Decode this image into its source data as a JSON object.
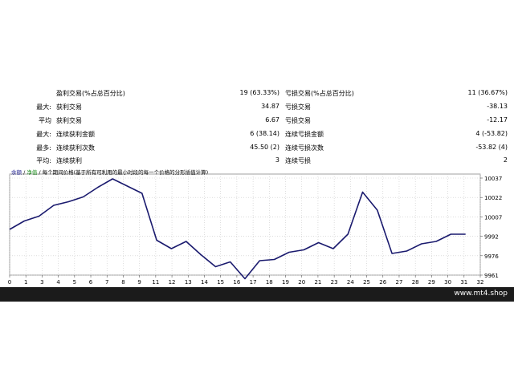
{
  "stats": [
    {
      "prefix": "",
      "label": "盈利交易(%占总百分比)",
      "value": "19 (63.33%)",
      "label2": "亏损交易(%占总百分比)",
      "value2": "11 (36.67%)"
    },
    {
      "prefix": "最大:",
      "label": "获利交易",
      "value": "34.87",
      "label2": "亏损交易",
      "value2": "-38.13"
    },
    {
      "prefix": "平均",
      "label": "获利交易",
      "value": "6.67",
      "label2": "亏损交易",
      "value2": "-12.17"
    },
    {
      "prefix": "最大:",
      "label": "连续获利金额",
      "value": "6 (38.14)",
      "label2": "连续亏损金额",
      "value2": "4 (-53.82)"
    },
    {
      "prefix": "最多:",
      "label": "连续获利次数",
      "value": "45.50 (2)",
      "label2": "连续亏损次数",
      "value2": "-53.82 (4)"
    },
    {
      "prefix": "平均:",
      "label": "连续获利",
      "value": "3",
      "label2": "连续亏损",
      "value2": "2"
    }
  ],
  "chart_title": {
    "balance": "余额",
    "sep": " / ",
    "equity": "净值",
    "rest": " / 每个期间价格(基于所有可利用的最小时段的每一个价格的分形插值计算)"
  },
  "chart_data": {
    "type": "line",
    "series": [
      {
        "name": "余额",
        "color": "#1a1a6e",
        "values": [
          [
            0,
            9999
          ],
          [
            1,
            10006
          ],
          [
            2,
            10010
          ],
          [
            3,
            10019
          ],
          [
            4,
            10022
          ],
          [
            5,
            10026
          ],
          [
            6,
            10034
          ],
          [
            7,
            10041
          ],
          [
            8,
            10035
          ],
          [
            9,
            10029
          ],
          [
            10,
            9990
          ],
          [
            11,
            9983
          ],
          [
            12,
            9989
          ],
          [
            13,
            9978
          ],
          [
            14,
            9968
          ],
          [
            15,
            9972
          ],
          [
            16,
            9958
          ],
          [
            17,
            9973
          ],
          [
            18,
            9974
          ],
          [
            19,
            9980
          ],
          [
            20,
            9982
          ],
          [
            21,
            9988
          ],
          [
            22,
            9983
          ],
          [
            23,
            9995
          ],
          [
            24,
            10030
          ],
          [
            25,
            10015
          ],
          [
            26,
            9979
          ],
          [
            27,
            9981
          ],
          [
            28,
            9987
          ],
          [
            29,
            9989
          ],
          [
            30,
            9995
          ],
          [
            31,
            9995
          ]
        ]
      }
    ],
    "x_ticks": [
      "0",
      "1",
      "3",
      "4",
      "5",
      "6",
      "7",
      "8",
      "9",
      "11",
      "12",
      "13",
      "14",
      "15",
      "16",
      "17",
      "18",
      "19",
      "20",
      "21",
      "23",
      "24",
      "25",
      "26",
      "27",
      "28",
      "29",
      "30",
      "31",
      "32"
    ],
    "y_ticks": [
      "10037",
      "10022",
      "10007",
      "9992",
      "9976",
      "9961"
    ],
    "ylim": [
      9961,
      10045
    ]
  },
  "footer": {
    "site": "www.mt4.shop"
  }
}
